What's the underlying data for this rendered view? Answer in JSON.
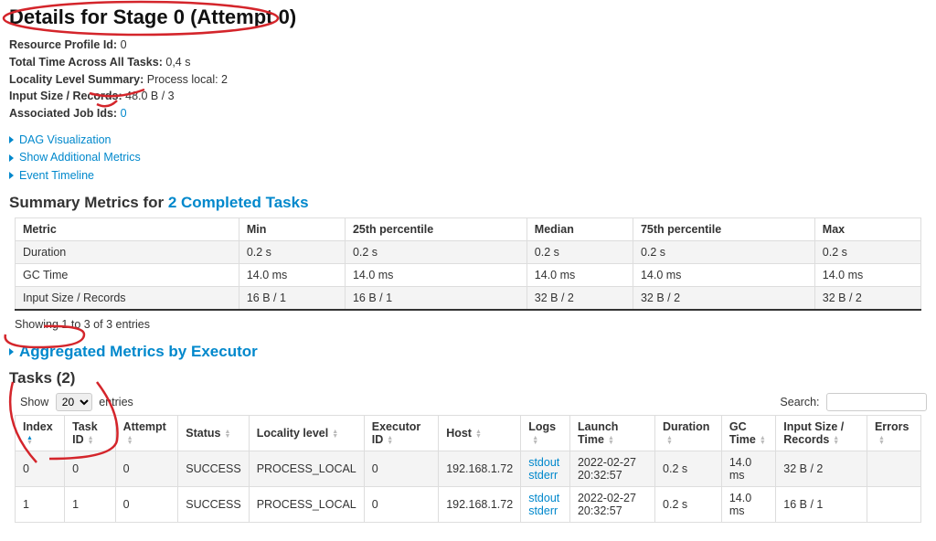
{
  "header": {
    "title": "Details for Stage 0 (Attempt 0)"
  },
  "details": {
    "resource_profile_label": "Resource Profile Id:",
    "resource_profile_value": "0",
    "total_time_label": "Total Time Across All Tasks:",
    "total_time_value": "0,4 s",
    "locality_label": "Locality Level Summary:",
    "locality_value": "Process local: 2",
    "input_size_label": "Input Size / Records:",
    "input_size_value": "48.0 B / 3",
    "assoc_jobs_label": "Associated Job Ids:",
    "assoc_jobs_value": "0"
  },
  "disclosures": {
    "dag": "DAG Visualization",
    "additional_metrics": "Show Additional Metrics",
    "event_timeline": "Event Timeline"
  },
  "summary_heading": {
    "prefix": "Summary Metrics for ",
    "link": "2 Completed Tasks"
  },
  "summary_table": {
    "headers": [
      "Metric",
      "Min",
      "25th percentile",
      "Median",
      "75th percentile",
      "Max"
    ],
    "rows": [
      [
        "Duration",
        "0.2 s",
        "0.2 s",
        "0.2 s",
        "0.2 s",
        "0.2 s"
      ],
      [
        "GC Time",
        "14.0 ms",
        "14.0 ms",
        "14.0 ms",
        "14.0 ms",
        "14.0 ms"
      ],
      [
        "Input Size / Records",
        "16 B / 1",
        "16 B / 1",
        "32 B / 2",
        "32 B / 2",
        "32 B / 2"
      ]
    ]
  },
  "entries_info": "Showing 1 to 3 of 3 entries",
  "agg_metrics_heading": "Aggregated Metrics by Executor",
  "tasks_heading": "Tasks (2)",
  "show_search": {
    "show_label": "Show",
    "show_value": "20",
    "entries_label": "entries",
    "search_label": "Search:"
  },
  "tasks_table": {
    "headers": [
      "Index",
      "Task ID",
      "Attempt",
      "Status",
      "Locality level",
      "Executor ID",
      "Host",
      "Logs",
      "Launch Time",
      "Duration",
      "GC Time",
      "Input Size / Records",
      "Errors"
    ],
    "rows": [
      {
        "index": "0",
        "task_id": "0",
        "attempt": "0",
        "status": "SUCCESS",
        "locality": "PROCESS_LOCAL",
        "executor_id": "0",
        "host": "192.168.1.72",
        "logs": {
          "stdout": "stdout",
          "stderr": "stderr"
        },
        "launch_time": "2022-02-27 20:32:57",
        "duration": "0.2 s",
        "gc_time": "14.0 ms",
        "input_size": "32 B / 2",
        "errors": ""
      },
      {
        "index": "1",
        "task_id": "1",
        "attempt": "0",
        "status": "SUCCESS",
        "locality": "PROCESS_LOCAL",
        "executor_id": "0",
        "host": "192.168.1.72",
        "logs": {
          "stdout": "stdout",
          "stderr": "stderr"
        },
        "launch_time": "2022-02-27 20:32:57",
        "duration": "0.2 s",
        "gc_time": "14.0 ms",
        "input_size": "16 B / 1",
        "errors": ""
      }
    ]
  }
}
